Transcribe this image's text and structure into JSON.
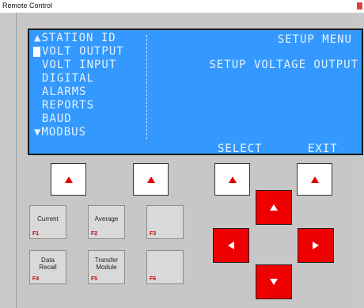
{
  "window": {
    "title": "Remote Control"
  },
  "lcd": {
    "menu": [
      {
        "prefix": "▲",
        "label": "STATION ID"
      },
      {
        "prefix": "",
        "label": "VOLT OUTPUT",
        "selected": true
      },
      {
        "prefix": "",
        "label": "VOLT INPUT"
      },
      {
        "prefix": "",
        "label": "DIGITAL"
      },
      {
        "prefix": "",
        "label": "ALARMS"
      },
      {
        "prefix": "",
        "label": "REPORTS"
      },
      {
        "prefix": "",
        "label": "BAUD"
      },
      {
        "prefix": "▼",
        "label": "MODBUS"
      }
    ],
    "right_title": "SETUP MENU",
    "right_subtitle": "SETUP VOLTAGE OUTPUT",
    "soft_label_3": "SELECT",
    "soft_label_4": "EXIT",
    "colors": {
      "background": "#3399ff",
      "text": "#e7f2ff"
    }
  },
  "function_keys": [
    {
      "label": "Current",
      "key": "F1"
    },
    {
      "label": "Average",
      "key": "F2"
    },
    {
      "label": "",
      "key": "F3"
    },
    {
      "label": "Data Recall",
      "line1": "Data",
      "line2": "Recall",
      "key": "F4"
    },
    {
      "label": "Transfer Module",
      "line1": "Transfer",
      "line2": "Module",
      "key": "F5"
    },
    {
      "label": "",
      "key": "F6"
    }
  ],
  "softkeys": [
    "up-triangle-icon",
    "up-triangle-icon",
    "up-triangle-icon",
    "up-triangle-icon"
  ],
  "arrows": {
    "color": "#ee0000",
    "icons": [
      "arrow-up-icon",
      "arrow-left-icon",
      "arrow-right-icon",
      "arrow-down-icon"
    ]
  }
}
